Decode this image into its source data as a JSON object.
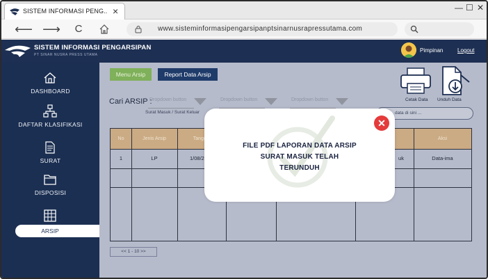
{
  "browser": {
    "tab_title": "SISTEM INFORMASI PENG..",
    "tab_close": "×",
    "minimize": "—",
    "maximize": "☐",
    "close": "✕",
    "back": "⟵",
    "forward": "⟶",
    "reload": "C",
    "url": "www.sisteminformasipengarsipanptsinarnusrapressutama.com"
  },
  "header": {
    "title": "SISTEM INFORMASI PENGARSIPAN",
    "subtitle": "PT SINAR NUSRA PRESS UTAMA",
    "user": "Pimpinan",
    "logout": "Logout"
  },
  "sidebar": {
    "items": [
      {
        "label": "DASHBOARD",
        "icon": "home-icon"
      },
      {
        "label": "DAFTAR KLASIFIKASI",
        "icon": "hierarchy-icon"
      },
      {
        "label": "SURAT",
        "icon": "letter-icon"
      },
      {
        "label": "DISPOSISI",
        "icon": "folder-icon"
      },
      {
        "label": "ARSIP",
        "icon": "archive-icon",
        "active": true
      }
    ]
  },
  "main": {
    "menu_button": "Menu Arsip",
    "report_button": "Report Data Arsip",
    "cari_label": "Cari ARSIP :",
    "dropdowns": [
      "Dropdown button",
      "Dropdown button",
      "Dropdown button"
    ],
    "filter_sub": "Surat Masuk / Surat Keluar",
    "search_placeholder": "data di sini ...",
    "print_label": "Cetak Data",
    "download_label": "Unduh Data",
    "table": {
      "headers": [
        "No",
        "Jenis Arsip",
        "Tanggal",
        "",
        "",
        "",
        "Aksi"
      ],
      "rows": [
        [
          "1",
          "LP",
          "1/08/2",
          "",
          "",
          "uk",
          "Data-ima"
        ]
      ]
    },
    "pager": "<< 1 - 10 >>"
  },
  "modal": {
    "line1": "FILE PDF LAPORAN DATA ARSIP",
    "line2": "SURAT MASUK TELAH",
    "line3": "TERUNDUH",
    "close": "✕"
  },
  "colors": {
    "sidebar": "#1b2f52",
    "header": "#1d2f52",
    "main_bg": "#b6bbcb",
    "menu_button": "#7fb05a",
    "table_header": "#cbab84",
    "close_red": "#e53b3b"
  }
}
